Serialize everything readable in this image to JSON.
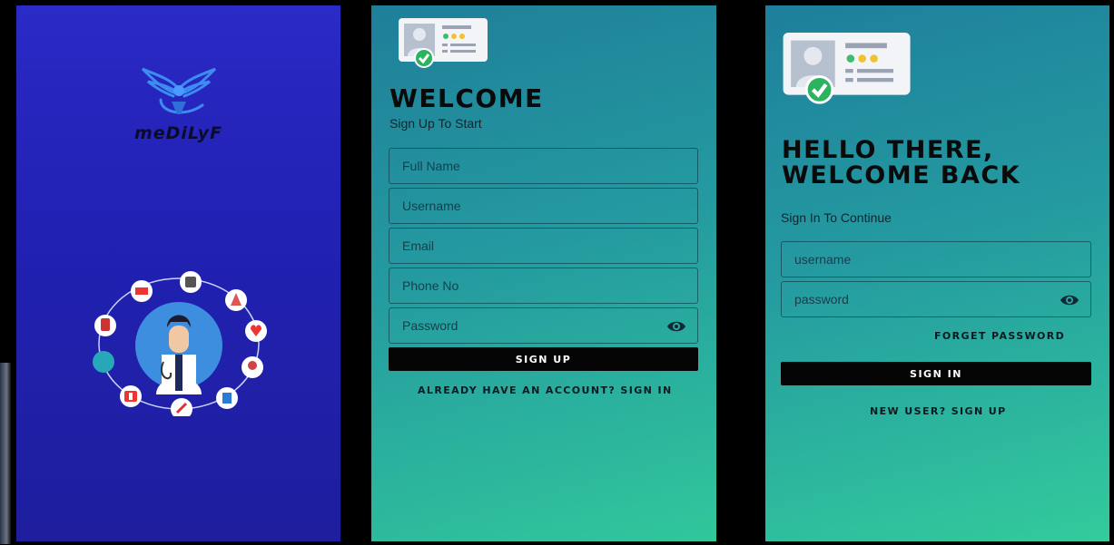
{
  "splash": {
    "brand_name": "meDiLyF",
    "colors": {
      "bg_top": "#2a2ac6",
      "bg_bottom": "#1e1e9e"
    }
  },
  "signup": {
    "title": "WELCOME",
    "subtitle": "Sign Up To Start",
    "fields": {
      "full_name": "Full Name",
      "username": "Username",
      "email": "Email",
      "phone": "Phone No",
      "password": "Password"
    },
    "submit_label": "SIGN UP",
    "switch_link": "ALREADY HAVE AN ACCOUNT? SIGN IN"
  },
  "signin": {
    "title_line1": "HELLO THERE,",
    "title_line2": "WELCOME BACK",
    "subtitle": "Sign In To Continue",
    "fields": {
      "username": "username",
      "password": "password"
    },
    "forgot_link": "FORGET PASSWORD",
    "submit_label": "SIGN IN",
    "switch_link": "NEW USER? SIGN UP"
  },
  "icons": {
    "logo": "winged-caduceus-icon",
    "id_card": "id-card-icon",
    "password_toggle": "eye-icon"
  },
  "colors": {
    "teal_top": "#1f7f99",
    "teal_bottom": "#31c79b",
    "button": "#050505"
  }
}
